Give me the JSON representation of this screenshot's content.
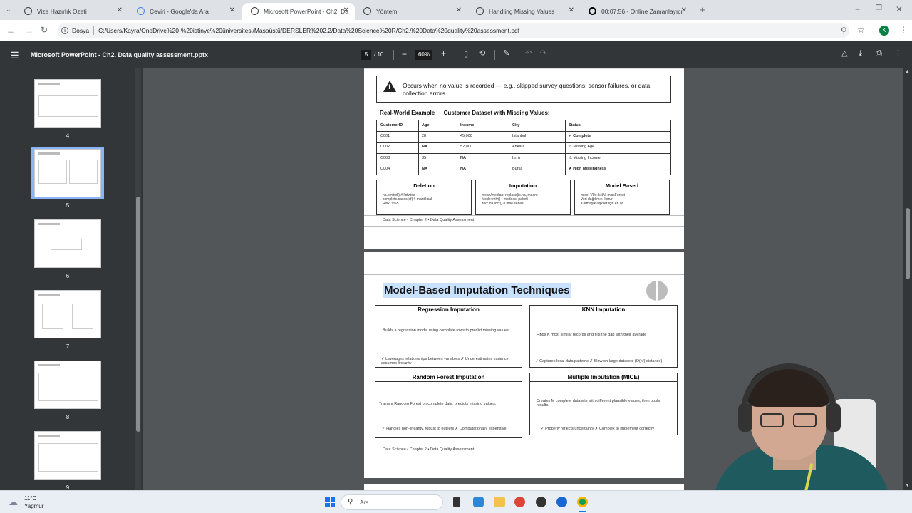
{
  "tabs": [
    {
      "label": "Vize Hazırlık Özeti"
    },
    {
      "label": "Çeviri - Google'da Ara"
    },
    {
      "label": "Microsoft PowerPoint - Ch2. Da"
    },
    {
      "label": "Yöntem"
    },
    {
      "label": "Handling Missing Values"
    },
    {
      "label": "00:07:56 - Online Zamanlayıcı"
    }
  ],
  "address": {
    "site_label": "Dosya",
    "url": "C:/Users/Kayra/OneDrive%20-%20istinye%20üniversitesi/Masaüstü/DERSLER%202.2/Data%20Science%20R/Ch2.%20Data%20quality%20assessment.pdf",
    "profile": "K"
  },
  "pdf": {
    "title": "Microsoft PowerPoint - Ch2. Data quality assessment.pptx",
    "page": "5",
    "total": "/ 10",
    "zoom": "60%"
  },
  "thumbnails": [
    {
      "num": "4"
    },
    {
      "num": "5"
    },
    {
      "num": "6"
    },
    {
      "num": "7"
    },
    {
      "num": "8"
    },
    {
      "num": "9"
    }
  ],
  "slide5": {
    "note": "Occurs when no value is recorded — e.g., skipped survey questions, sensor failures, or data collection errors.",
    "table_title": "Real-World Example — Customer Dataset with Missing Values:",
    "headers": [
      "CustomerID",
      "Age",
      "Income",
      "City",
      "Status"
    ],
    "rows": [
      [
        "C001",
        "28",
        "45,000",
        "Istanbul",
        "✓ Complete"
      ],
      [
        "C002",
        "NA",
        "52,000",
        "Ankara",
        "⚠ Missing Age"
      ],
      [
        "C003",
        "35",
        "NA",
        "Izmir",
        "⚠ Missing Income"
      ],
      [
        "C004",
        "NA",
        "NA",
        "Bursa",
        "✗ High Missingness"
      ]
    ],
    "boxes": [
      {
        "title": "Deletion",
        "lines": [
          "na.omit(df)  # listwise",
          "complete.cases(df)  # mantıksal",
          "Risk: ≥%5"
        ]
      },
      {
        "title": "Imputation",
        "lines": [
          "mean/median: replace(is.na, mean)",
          "Mode: mlv() - modeest paketi",
          "zoo::na.locf()  # time series"
        ]
      },
      {
        "title": "Model Based",
        "lines": [
          "mice, VIM::kNN, missForest",
          "Veri dağılımını korur",
          "Karmaşık ilişkiler için en iyi"
        ]
      }
    ],
    "footer": "Data Science  •  Chapter 2  •  Data Quality Assessment"
  },
  "slide6": {
    "title": "Model-Based Imputation Techniques",
    "cards": [
      {
        "title": "Regression Imputation",
        "desc": "Builds a regression model using complete rows to predict missing values.",
        "pros": "✓ Leverages relationships between variables   ✗ Underestimates variance, assumes linearity"
      },
      {
        "title": "KNN Imputation",
        "desc": "Finds K most similar records and fills the gap with their average",
        "pros": "✓ Captures local data patterns   ✗ Slow on large datasets (O(n²) distance)"
      },
      {
        "title": "Random Forest Imputation",
        "desc": "Trains a Random Forest on complete data; predicts missing values.",
        "pros": "✓ Handles non-linearity, robust to outliers   ✗ Computationally expensive"
      },
      {
        "title": "Multiple Imputation (MICE)",
        "desc": "Creates M complete datasets with different plausible values, then pools results.",
        "pros": "✓ Properly reflects uncertainty   ✗ Complex to implement correctly"
      }
    ],
    "footer": "Data Science  •  Chapter 2  •  Data Quality Assessment"
  },
  "taskbar": {
    "temp": "11°C",
    "weather": "Yağmur",
    "search": "Ara"
  }
}
